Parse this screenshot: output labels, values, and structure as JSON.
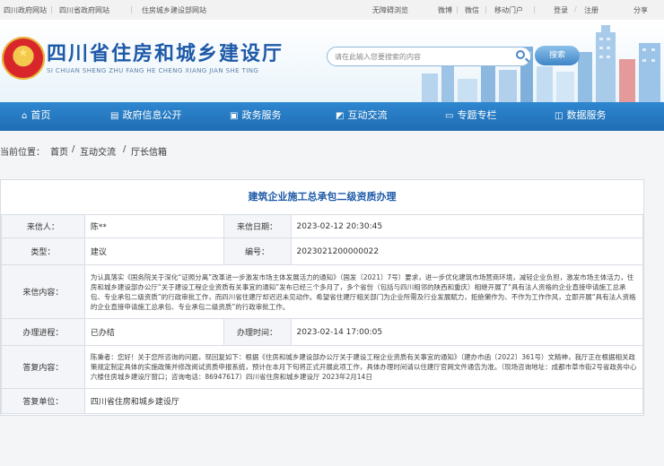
{
  "topbar": {
    "links": [
      "四川政府网站",
      "四川省政府网站",
      "住房城乡建设部网站"
    ],
    "accessibility": "无障碍浏览",
    "social": [
      "微博",
      "微信",
      "移动门户"
    ],
    "login": "登录",
    "register": "注册",
    "share": "分享"
  },
  "header": {
    "title": "四川省住房和城乡建设厅",
    "subtitle": "SI CHUAN SHENG ZHU FANG HE CHENG XIANG JIAN SHE TING",
    "search": {
      "placeholder": "请在此输入您要搜索的内容",
      "button": "搜索"
    }
  },
  "nav": {
    "items": [
      {
        "label": "首页",
        "icon": "home-icon"
      },
      {
        "label": "政府信息公开",
        "icon": "document-icon"
      },
      {
        "label": "政务服务",
        "icon": "service-icon"
      },
      {
        "label": "互动交流",
        "icon": "chat-icon"
      },
      {
        "label": "专题专栏",
        "icon": "folder-icon"
      },
      {
        "label": "数据服务",
        "icon": "data-icon"
      }
    ]
  },
  "breadcrumb": {
    "prefix": "当前位置：",
    "items": [
      "首页",
      "互动交流",
      "厅长信箱"
    ],
    "separator": "/"
  },
  "letter": {
    "title": "建筑企业施工总承包二级资质办理",
    "sender_label": "来信人：",
    "sender": "陈**",
    "date_label": "来信日期：",
    "date": "2023-02-12 20:30:45",
    "type_label": "类型：",
    "type": "建议",
    "number_label": "编号：",
    "number": "2023021200000022",
    "content_label": "来信内容：",
    "content": "为认真落实《国务院关于深化“证照分离”改革进一步激发市场主体发展活力的通知》（国发〔2021〕7号）要求，进一步优化建筑市场营商环境，减轻企业负担，激发市场主体活力，住房和城乡建设部办公厅“关于建设工程企业资质有关事宜的通知”发布已经三个多月了，多个省份（包括与四川相邻的陕西和重庆）相继开展了“具有法人资格的企业直接申请施工总承包、专业承包二级资质”的行政审批工作，而四川省住建厅却迟迟未见动作。希望省住建厅相关部门为企业所需及行业发展赋力，拒绝懒作为、不作为工作作风，立即开展“具有法人资格的企业直接申请施工总承包、专业承包二级资质”的行政审批工作。",
    "progress_label": "办理进程：",
    "progress": "已办结",
    "handle_time_label": "办理时间：",
    "handle_time": "2023-02-14 17:00:05",
    "reply_label": "答复内容：",
    "reply": "陈秉者：您好！关于您所咨询的问题，现回复如下：根据《住房和城乡建设部办公厅关于建设工程企业资质有关事宜的通知》（建办市函〔2022〕361号）文精神，我厅正在根据相关政策规定制定具体的实施政策并修改阅试资质申报系统，预计在本月下旬将正式开展此项工作，具体办理时间请以住建厅官网文件通告为准。（现场咨询地址：成都市草市街2号省政务中心六楼住房城乡建设厅窗口；咨询电话：86947617）四川省住房和城乡建设厅 2023年2月14日",
    "unit_label": "答复单位：",
    "unit": "四川省住房和城乡建设厅"
  },
  "colors": {
    "brand_blue": "#1e5aa8",
    "nav_blue": "#2a7fc8",
    "emblem_red": "#d8262b"
  }
}
